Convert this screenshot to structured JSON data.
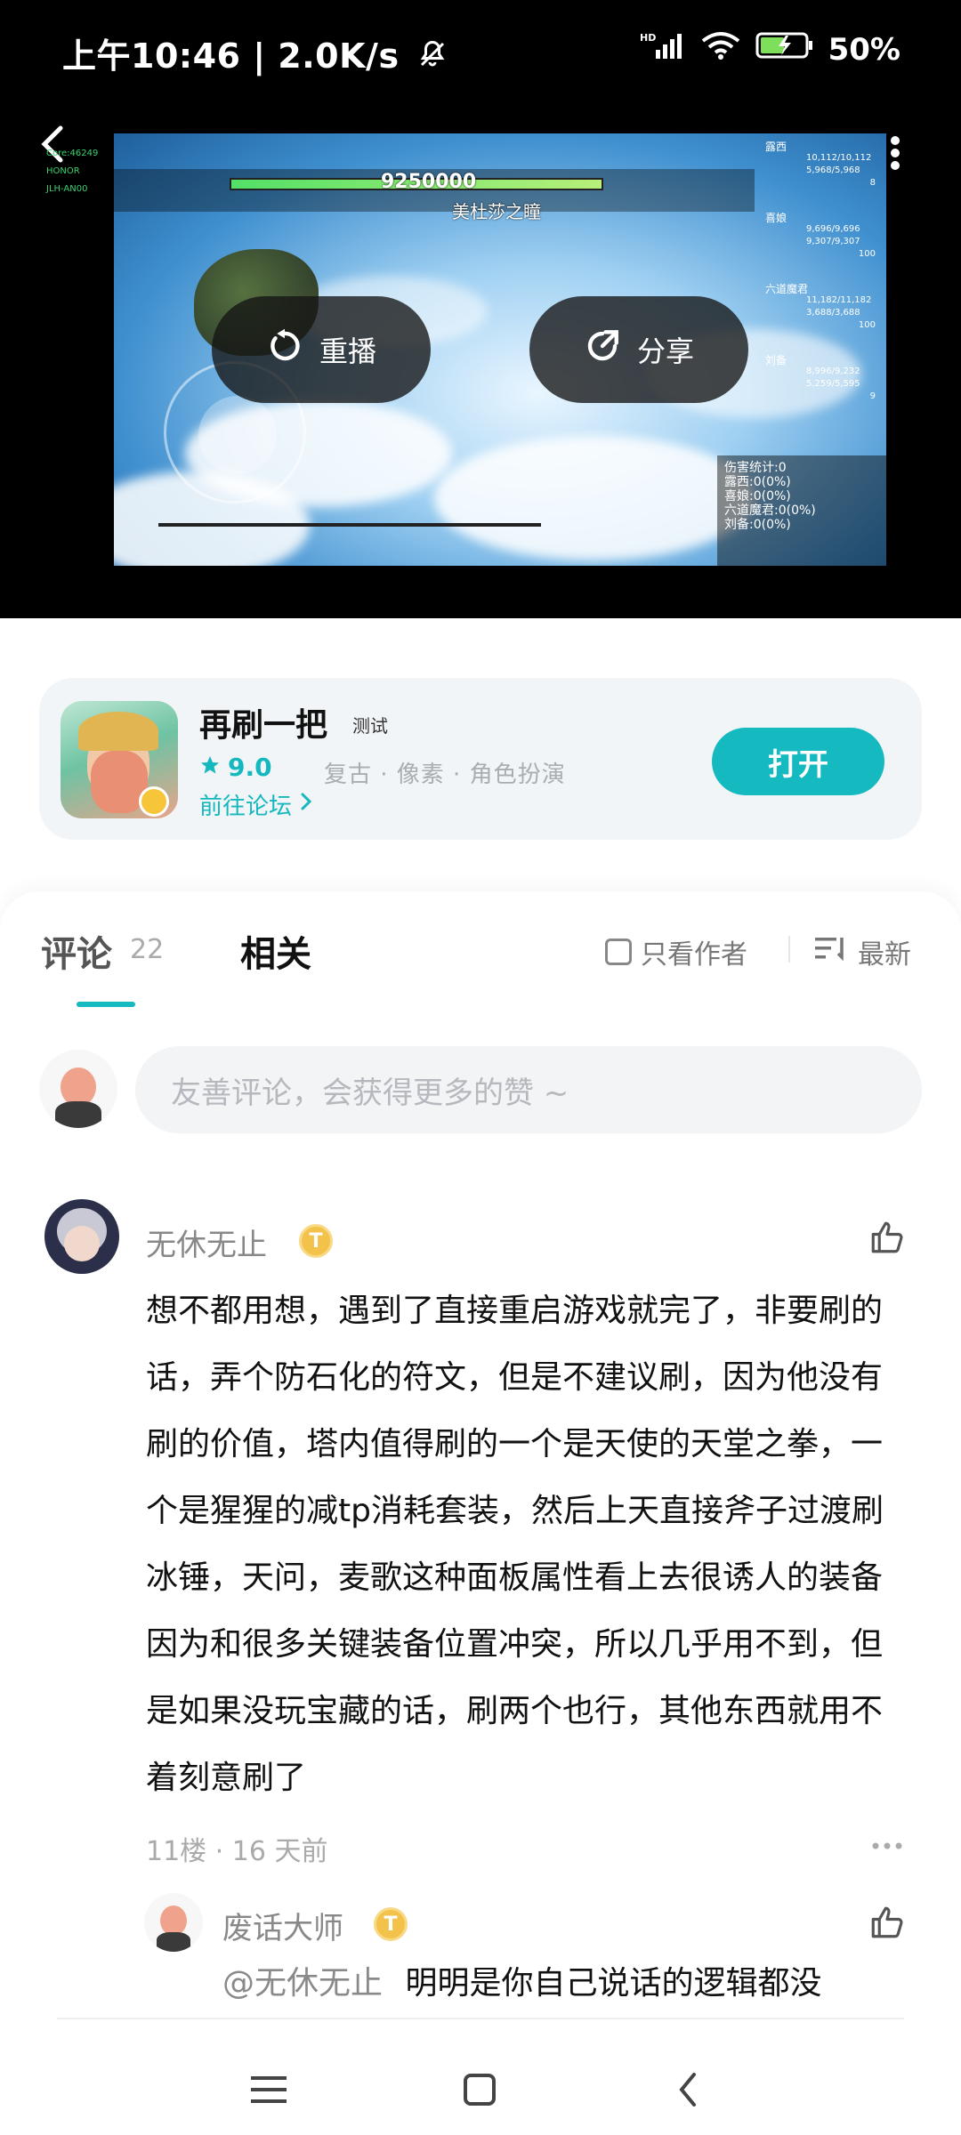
{
  "status_bar": {
    "left_text": "上午10:46 | 2.0K/s",
    "battery": "50%"
  },
  "video": {
    "hud_number": "9250000",
    "boss_name": "美杜莎之瞳",
    "replay_label": "重播",
    "share_label": "分享",
    "party": [
      {
        "name": "露西",
        "hp": "10,112/10,112",
        "mp": "5,968/5,968",
        "tp": "8"
      },
      {
        "name": "喜娘",
        "hp": "9,696/9,696",
        "mp": "9,307/9,307",
        "tp": "100"
      },
      {
        "name": "六道魔君",
        "hp": "11,182/11,182",
        "mp": "3,688/3,688",
        "tp": "100"
      },
      {
        "name": "刘备",
        "hp": "8,996/9,232",
        "mp": "5,259/5,595",
        "tp": "9"
      }
    ],
    "damage_panel": [
      "伤害统计:0",
      "露西:0(0%)",
      "喜娘:0(0%)",
      "六道魔君:0(0%)",
      "刘备:0(0%)"
    ],
    "overlay_lines": [
      "Core:46249",
      "HONOR",
      "JLH-AN00"
    ]
  },
  "app_card": {
    "name": "再刷一把",
    "tag": "测试",
    "rating": "9.0",
    "tags": "复古 · 像素 · 角色扮演",
    "forum_link": "前往论坛",
    "open_button": "打开"
  },
  "tabs": {
    "comment_label": "评论",
    "comment_count": "22",
    "related_label": "相关",
    "only_author": "只看作者",
    "sort_label": "最新"
  },
  "comment_input": {
    "placeholder": "友善评论，会获得更多的赞 ~"
  },
  "comment": {
    "author": "无休无止",
    "badge": "T",
    "body": "想不都用想，遇到了直接重启游戏就完了，非要刷的话，弄个防石化的符文，但是不建议刷，因为他没有刷的价值，塔内值得刷的一个是天使的天堂之拳，一个是猩猩的减tp消耗套装，然后上天直接斧子过渡刷冰锤，天问，麦歌这种面板属性看上去很诱人的装备因为和很多关键装备位置冲突，所以几乎用不到，但是如果没玩宝藏的话，刷两个也行，其他东西就用不着刻意刷了",
    "meta": "11楼 · 16 天前"
  },
  "reply": {
    "author": "废话大师",
    "badge": "T",
    "at": "@无休无止",
    "text": "明明是你自己说话的逻辑都没"
  },
  "colors": {
    "accent": "#15b9c0",
    "badge": "#f3c24a"
  }
}
